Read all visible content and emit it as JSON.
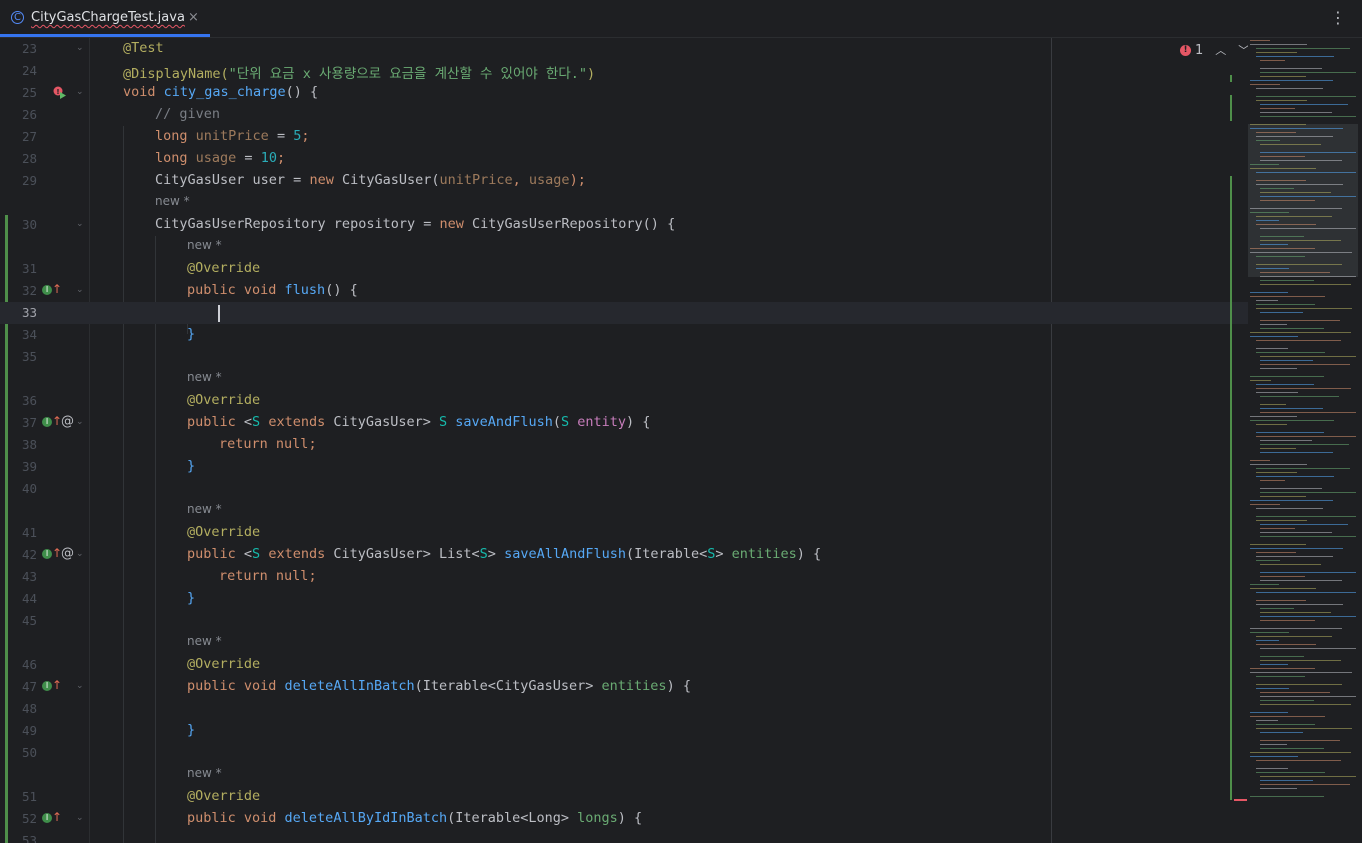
{
  "tab": {
    "icon": "C",
    "filename": "CityGasChargeTest.java",
    "close": "×",
    "menu": "⋮"
  },
  "inspections": {
    "error_count": "1",
    "up": "^",
    "down": "v"
  },
  "inlay_hint": "new *",
  "lines": [
    {
      "n": "23",
      "hint": false
    },
    {
      "n": "24",
      "hint": false
    },
    {
      "n": "25",
      "hint": false
    },
    {
      "n": "26",
      "hint": false
    },
    {
      "n": "27",
      "hint": false
    },
    {
      "n": "28",
      "hint": false
    },
    {
      "n": "29",
      "hint": false
    },
    {
      "n": "30",
      "hint": true
    },
    {
      "n": "31",
      "hint": true
    },
    {
      "n": "32",
      "hint": false
    },
    {
      "n": "33",
      "hint": false
    },
    {
      "n": "34",
      "hint": false
    },
    {
      "n": "35",
      "hint": false
    },
    {
      "n": "36",
      "hint": true
    },
    {
      "n": "37",
      "hint": false
    },
    {
      "n": "38",
      "hint": false
    },
    {
      "n": "39",
      "hint": false
    },
    {
      "n": "40",
      "hint": false
    },
    {
      "n": "41",
      "hint": true
    },
    {
      "n": "42",
      "hint": false
    },
    {
      "n": "43",
      "hint": false
    },
    {
      "n": "44",
      "hint": false
    },
    {
      "n": "45",
      "hint": false
    },
    {
      "n": "46",
      "hint": true
    },
    {
      "n": "47",
      "hint": false
    },
    {
      "n": "48",
      "hint": false
    },
    {
      "n": "49",
      "hint": false
    },
    {
      "n": "50",
      "hint": false
    },
    {
      "n": "51",
      "hint": true
    },
    {
      "n": "52",
      "hint": false
    },
    {
      "n": "53",
      "hint": false
    }
  ],
  "code": {
    "l23": "@Test",
    "l24_ann": "@DisplayName(",
    "l24_str": "\"단위 요금 x 사용량으로 요금을 계산할 수 있어야 한다.\"",
    "l24_end": ")",
    "l25_kw": "void",
    "l25_fn": "city_gas_charge",
    "l25_end": "() {",
    "l26": "// given",
    "l27_kw": "long",
    "l27_var": "unitPrice",
    "l27_eq": " = ",
    "l27_num": "5",
    "l27_end": ";",
    "l28_kw": "long",
    "l28_var": "usage",
    "l28_eq": " = ",
    "l28_num": "10",
    "l28_end": ";",
    "l29_type": "CityGasUser user = ",
    "l29_new": "new",
    "l29_call": " CityGasUser(",
    "l29_a1": "unitPrice",
    "l29_sep": ", ",
    "l29_a2": "usage",
    "l29_end": ");",
    "l30_type": "CityGasUserRepository repository = ",
    "l30_new": "new",
    "l30_end": " CityGasUserRepository() {",
    "override": "@Override",
    "l32_kw": "public void",
    "l32_fn": "flush",
    "l32_end": "() {",
    "close_brace": "}",
    "l37_kw": "public",
    "l37_lt": " <",
    "l37_s": "S",
    "l37_ext": " extends",
    "l37_type": " CityGasUser> ",
    "l37_s2": "S",
    "l37_fn": "saveAndFlush",
    "l37_open": "(",
    "l37_s3": "S",
    "l37_param": "entity",
    "l37_end": ") {",
    "ret_kw": "return",
    "ret_null": "null",
    "ret_end": ";",
    "l42_kw": "public",
    "l42_lt": " <",
    "l42_s": "S",
    "l42_ext": " extends",
    "l42_type": " CityGasUser> List<",
    "l42_s2": "S",
    "l42_gt": "> ",
    "l42_fn": "saveAllAndFlush",
    "l42_open": "(Iterable<",
    "l42_s3": "S",
    "l42_gt2": "> ",
    "l42_param": "entities",
    "l42_end": ") {",
    "l47_kw": "public void",
    "l47_fn": "deleteAllInBatch",
    "l47_open": "(Iterable<CityGasUser> ",
    "l47_param": "entities",
    "l47_end": ") {",
    "l52_kw": "public void",
    "l52_fn": "deleteAllByIdInBatch",
    "l52_open": "(Iterable<Long> ",
    "l52_param": "longs",
    "l52_end": ") {"
  },
  "colors": {
    "background": "#1e1f22",
    "keyword": "#cf8e6d",
    "annotation": "#b3ae60",
    "function": "#56a8f5",
    "string": "#6aab73",
    "number": "#2aacb8",
    "comment": "#7a7e85",
    "vcs_added": "#4f8f4a",
    "error": "#e55765",
    "accent": "#3574f0"
  },
  "icons": {
    "run_test": "run-test-icon",
    "implements": "implements-icon",
    "override_up": "override-up-arrow-icon",
    "annotation_at": "at-icon",
    "fold": "fold-chevron-icon",
    "error": "error-icon"
  }
}
